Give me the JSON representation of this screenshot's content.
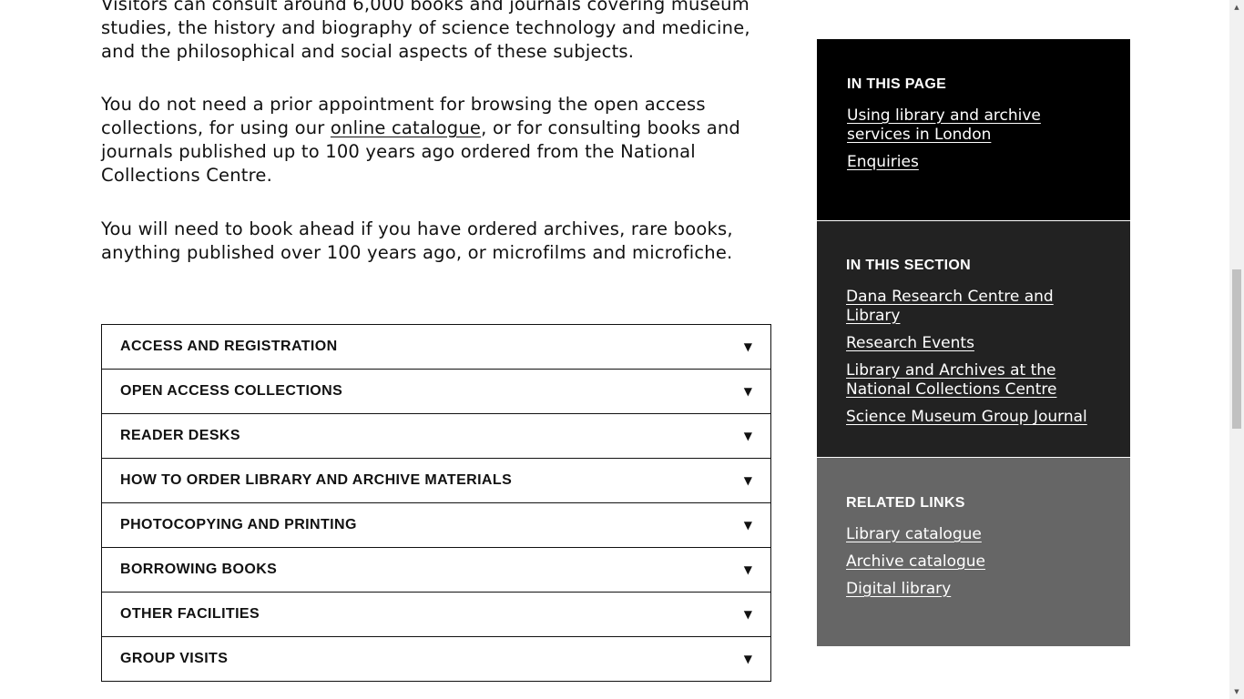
{
  "main": {
    "para1": "Visitors can consult around 6,000 books and journals covering museum studies, the history and biography of science technology and medicine, and the philosophical and social aspects of these subjects.",
    "para2_before": "You do not need a prior appointment for browsing the open access collections, for using our ",
    "para2_link": "online catalogue",
    "para2_after": ", or for consulting books and journals published up to 100 years ago ordered from the National Collections Centre.",
    "para3": "You will need to book ahead if you have ordered archives, rare books, anything published over 100 years ago, or microfilms and microfiche."
  },
  "accordion": [
    {
      "label": "ACCESS AND REGISTRATION",
      "arrow": "▼"
    },
    {
      "label": "OPEN ACCESS COLLECTIONS",
      "arrow": "▼"
    },
    {
      "label": "READER DESKS",
      "arrow": "▼"
    },
    {
      "label": "HOW TO ORDER LIBRARY AND ARCHIVE MATERIALS",
      "arrow": "▼"
    },
    {
      "label": "PHOTOCOPYING AND PRINTING",
      "arrow": "▼"
    },
    {
      "label": "BORROWING BOOKS",
      "arrow": "▼"
    },
    {
      "label": "OTHER FACILITIES",
      "arrow": "▼"
    },
    {
      "label": "GROUP VISITS",
      "arrow": "▼"
    }
  ],
  "sidebar": {
    "in_this_page": {
      "heading": "IN THIS PAGE",
      "links": [
        "Using library and archive services in London",
        "Enquiries"
      ]
    },
    "in_this_section": {
      "heading": "IN THIS SECTION",
      "links": [
        "Dana Research Centre and Library",
        "Research Events",
        "Library and Archives at the National Collections Centre",
        "Science Museum Group Journal"
      ]
    },
    "related_links": {
      "heading": "RELATED LINKS",
      "links": [
        "Library catalogue",
        "Archive catalogue",
        "Digital library"
      ]
    }
  },
  "scrollbar": {
    "up_icon": "▲",
    "down_icon": "▼"
  },
  "colors": {
    "box_black": "#000000",
    "box_dark": "#222222",
    "box_grey": "#666666",
    "text": "#111111"
  }
}
